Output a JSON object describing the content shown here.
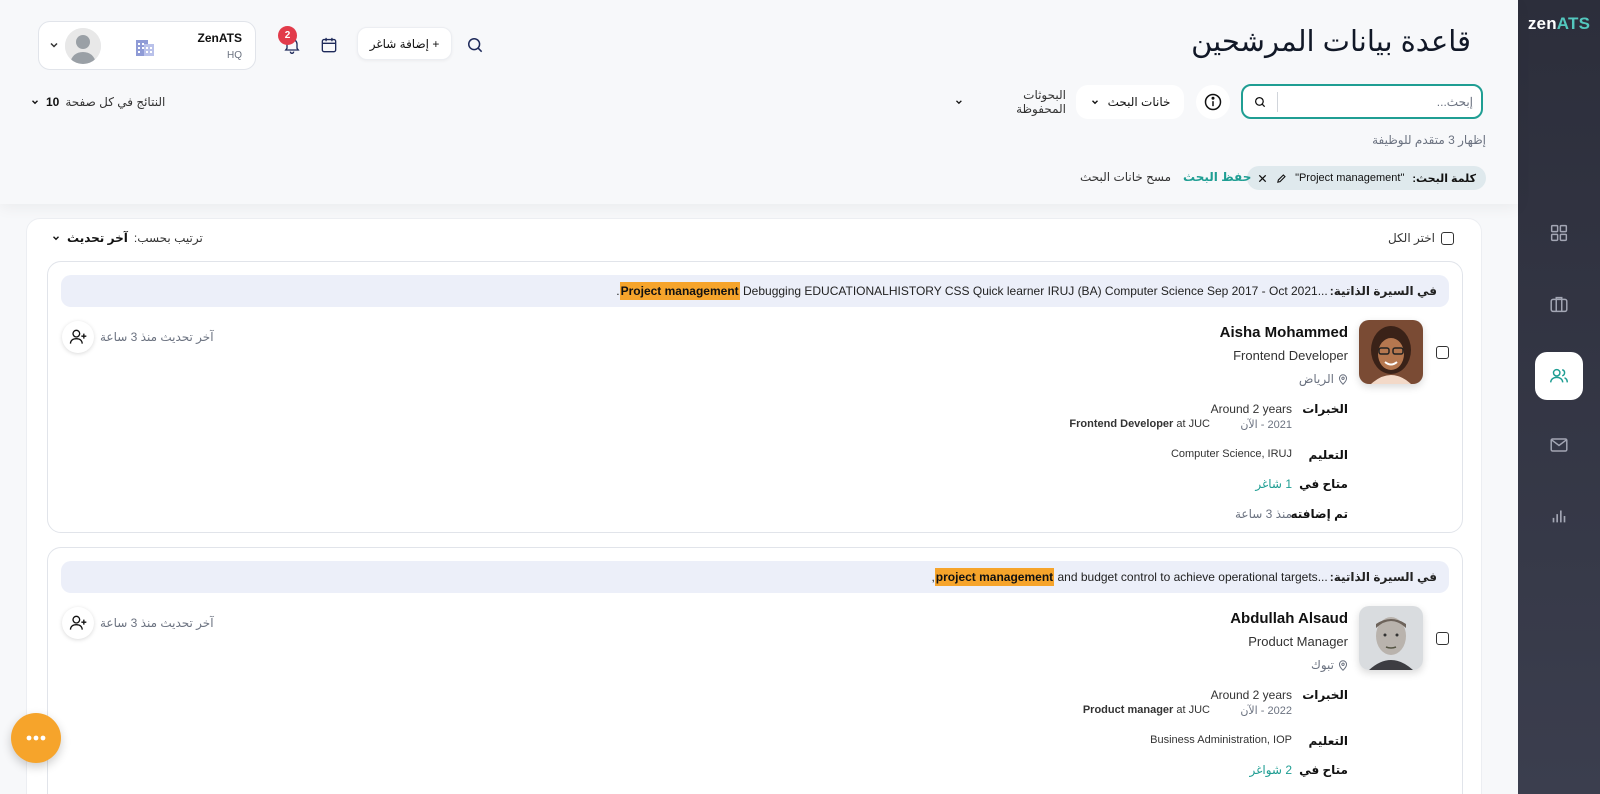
{
  "app": {
    "brand_left": "zen",
    "brand_right": "ATS"
  },
  "header": {
    "title": "قاعدة بيانات المرشحين",
    "profile": {
      "name": "ZenATS",
      "sub": "HQ"
    },
    "notifications_count": "2",
    "add_job_label": "+ إضافة شاغر"
  },
  "search": {
    "placeholder": "إبحث...",
    "fields_label": "خانات البحث",
    "saved_label": "البحوثات المحفوظة",
    "per_page_label": "النتائج في كل صفحة",
    "per_page_value": "10",
    "showing_text": "إظهار 3 متقدم للوظيفة",
    "chip_label": "كلمة البحث:",
    "chip_value": "\"Project management\"",
    "save_search": "حفظ البحث",
    "clear_fields": "مسح خانات البحث"
  },
  "results": {
    "select_all": "اختر الكل",
    "sort_label": "ترتيب بحسب:",
    "sort_value": "آخر تحديث",
    "candidates": [
      {
        "cv_label": "في السيرة الذاتية:",
        "cv_pre": "...Debugging EDUCATIONALHISTORY CSS Quick learner IRUJ (BA) Computer Science Sep 2017 - Oct 2021",
        "cv_highlight": "Project management",
        "cv_post": ".",
        "name": "Aisha Mohammed",
        "role": "Frontend Developer",
        "location": "الرياض",
        "exp_label": "الخبرات",
        "exp_duration": "Around 2 years",
        "exp_dates": "2021 - الآن",
        "exp_title": "Frontend Developer",
        "exp_at": "at JUC",
        "edu_label": "التعليم",
        "edu_value": "Computer Science, IRUJ",
        "avail_label": "متاح في",
        "avail_value": "1 شاغر",
        "added_label": "تم إضافته",
        "added_value": "منذ 3 ساعة",
        "last_update": "آخر تحديث منذ 3 ساعة"
      },
      {
        "cv_label": "في السيرة الذاتية:",
        "cv_pre": "...and budget control to achieve operational targets",
        "cv_highlight": "project management",
        "cv_post": ",",
        "name": "Abdullah Alsaud",
        "role": "Product Manager",
        "location": "تبوك",
        "exp_label": "الخبرات",
        "exp_duration": "Around 2 years",
        "exp_dates": "2022 - الآن",
        "exp_title": "Product manager",
        "exp_at": "at JUC",
        "edu_label": "التعليم",
        "edu_value": "Business Administration, IOP",
        "avail_label": "متاح في",
        "avail_value": "2 شواغر",
        "last_update": "آخر تحديث منذ 3 ساعة"
      }
    ]
  },
  "colors": {
    "accent": "#1f9e93",
    "highlight": "#f6a42b",
    "sidebar": "#2c2e3b",
    "badge": "#e23b4a"
  },
  "icons": {
    "sidebar": [
      "dashboard-icon",
      "briefcase-icon",
      "users-icon",
      "mail-icon",
      "chart-icon"
    ],
    "header": [
      "search-icon",
      "calendar-icon",
      "bell-icon",
      "building-icon",
      "chevron-down-icon"
    ]
  }
}
